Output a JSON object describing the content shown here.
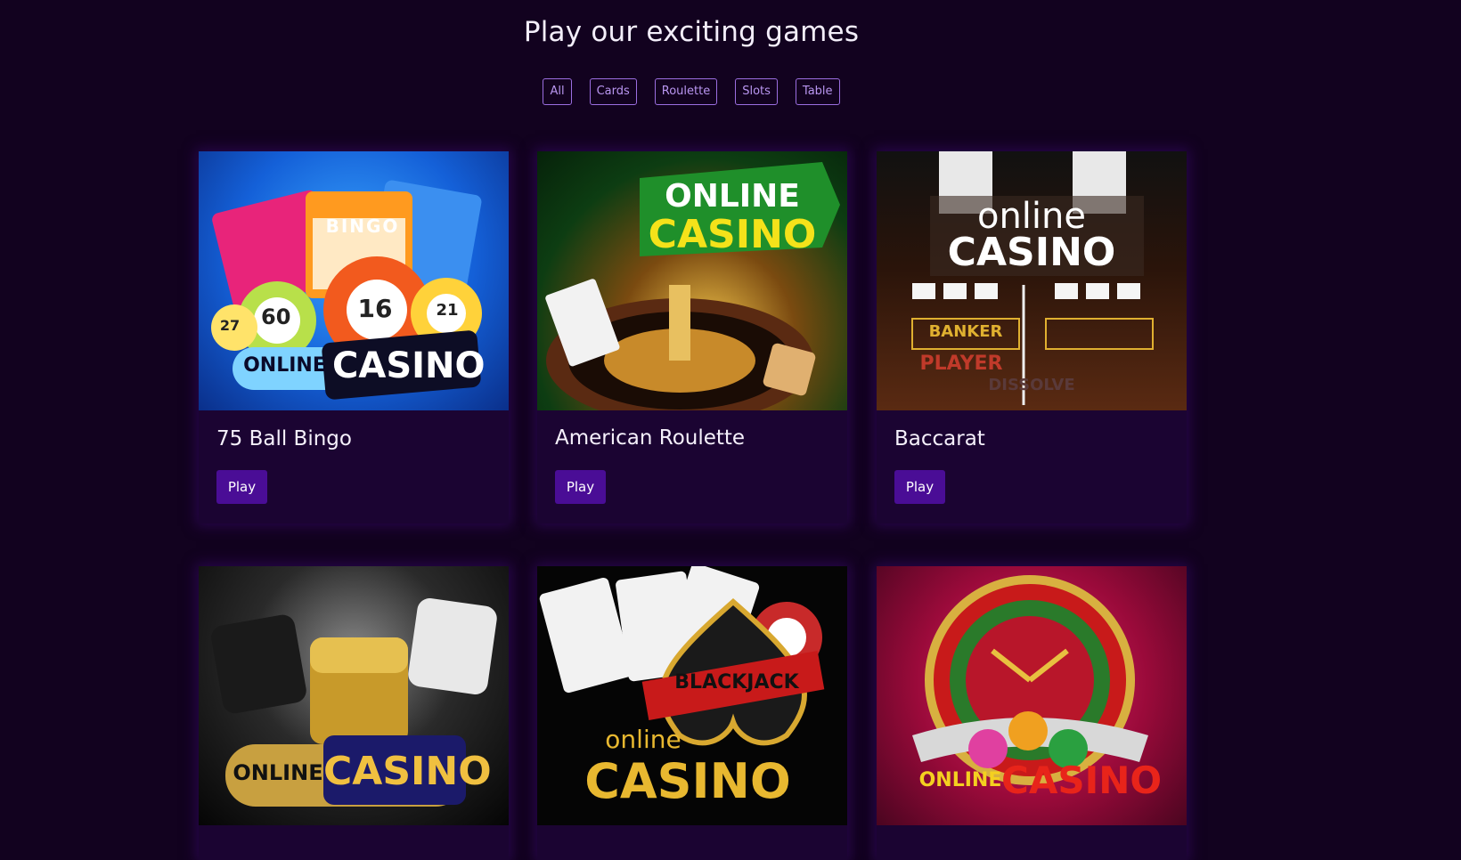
{
  "heading": "Play our exciting games",
  "filters": [
    "All",
    "Cards",
    "Roulette",
    "Slots",
    "Table"
  ],
  "play_label": "Play",
  "games": [
    {
      "title": "75 Ball Bingo",
      "logo_line1": "ONLINE",
      "logo_line2": "CASINO",
      "bingo": "BINGO",
      "balls": [
        "27",
        "60",
        "16",
        "21"
      ]
    },
    {
      "title": "American Roulette",
      "logo_line1": "ONLINE",
      "logo_line2": "CASINO"
    },
    {
      "title": "Baccarat",
      "logo_line1": "online",
      "logo_line2": "CASINO",
      "banker": "BANKER",
      "player": "PLAYER",
      "watermark": "DISSOLVE"
    },
    {
      "title": "",
      "logo_line1": "ONLINE",
      "logo_line2": "CASINO"
    },
    {
      "title": "",
      "logo_line1": "online",
      "logo_line2": "CASINO",
      "blackjack": "BLACKJACK"
    },
    {
      "title": "",
      "logo_line1": "ONLINE",
      "logo_line2": "CASINO"
    }
  ],
  "colors": {
    "background": "#12021f",
    "card": "#1b0432",
    "button": "#4a0d96",
    "filter_border": "#9b6ee0"
  }
}
